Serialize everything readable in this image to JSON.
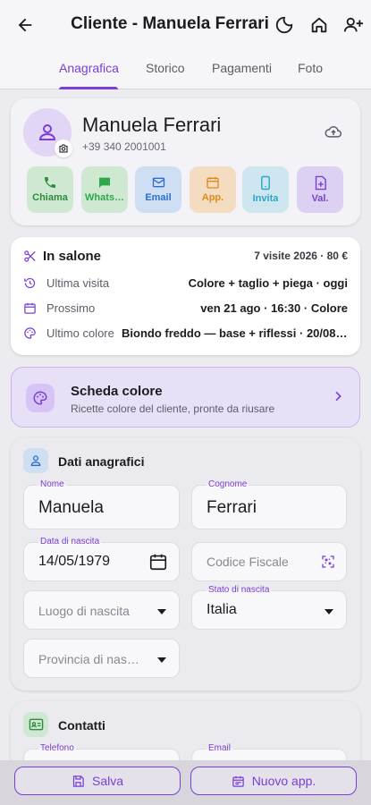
{
  "appbar": {
    "title": "Cliente - Manuela Ferrari",
    "back_icon": "arrow-left-icon",
    "actions": [
      "theme-toggle-icon",
      "home-icon",
      "add-person-icon"
    ]
  },
  "tabs": [
    {
      "label": "Anagrafica",
      "active": true
    },
    {
      "label": "Storico",
      "active": false
    },
    {
      "label": "Pagamenti",
      "active": false
    },
    {
      "label": "Foto",
      "active": false
    }
  ],
  "client": {
    "name": "Manuela Ferrari",
    "phone": "+39 340 2001001"
  },
  "quick_actions": [
    {
      "label": "Chiama",
      "icon": "phone-icon",
      "color": "#2e8b3d",
      "bg": "#cfe8d2"
    },
    {
      "label": "Whats…",
      "icon": "chat-icon",
      "color": "#2ea84a",
      "bg": "#cfe8d2"
    },
    {
      "label": "Email",
      "icon": "mail-icon",
      "color": "#2a6ed1",
      "bg": "#cfdff3"
    },
    {
      "label": "App.",
      "icon": "calendar-icon",
      "color": "#e08a1e",
      "bg": "#f3dcc0"
    },
    {
      "label": "Invita",
      "icon": "mobile-icon",
      "color": "#2aa7c9",
      "bg": "#cde6ef"
    },
    {
      "label": "Val.",
      "icon": "document-plus-icon",
      "color": "#7a3fd6",
      "bg": "#ddd1f3"
    }
  ],
  "salone": {
    "title": "In salone",
    "summary": "7 visite 2026 · 80 €",
    "rows": [
      {
        "key": "Ultima visita",
        "value": "Colore + taglio + piega · oggi"
      },
      {
        "key": "Prossimo",
        "value": "ven 21 ago · 16:30 · Colore"
      },
      {
        "key": "Ultimo colore",
        "value": "Biondo freddo — base + riflessi · 20/08/20…"
      }
    ]
  },
  "scheda": {
    "title": "Scheda colore",
    "subtitle": "Ricette colore del cliente, pronte da riusare"
  },
  "dati": {
    "title": "Dati anagrafici",
    "nome_label": "Nome",
    "nome_value": "Manuela",
    "cognome_label": "Cognome",
    "cognome_value": "Ferrari",
    "nascita_label": "Data di nascita",
    "nascita_value": "14/05/1979",
    "cf_placeholder": "Codice Fiscale",
    "luogo_placeholder": "Luogo di nascita",
    "stato_label": "Stato di nascita",
    "stato_value": "Italia",
    "provincia_placeholder": "Provincia di nas…"
  },
  "contatti": {
    "title": "Contatti",
    "telefono_label": "Telefono",
    "email_label": "Email"
  },
  "bottom": {
    "save": "Salva",
    "new_app": "Nuovo app."
  },
  "colors": {
    "accent": "#7a3fd6"
  }
}
